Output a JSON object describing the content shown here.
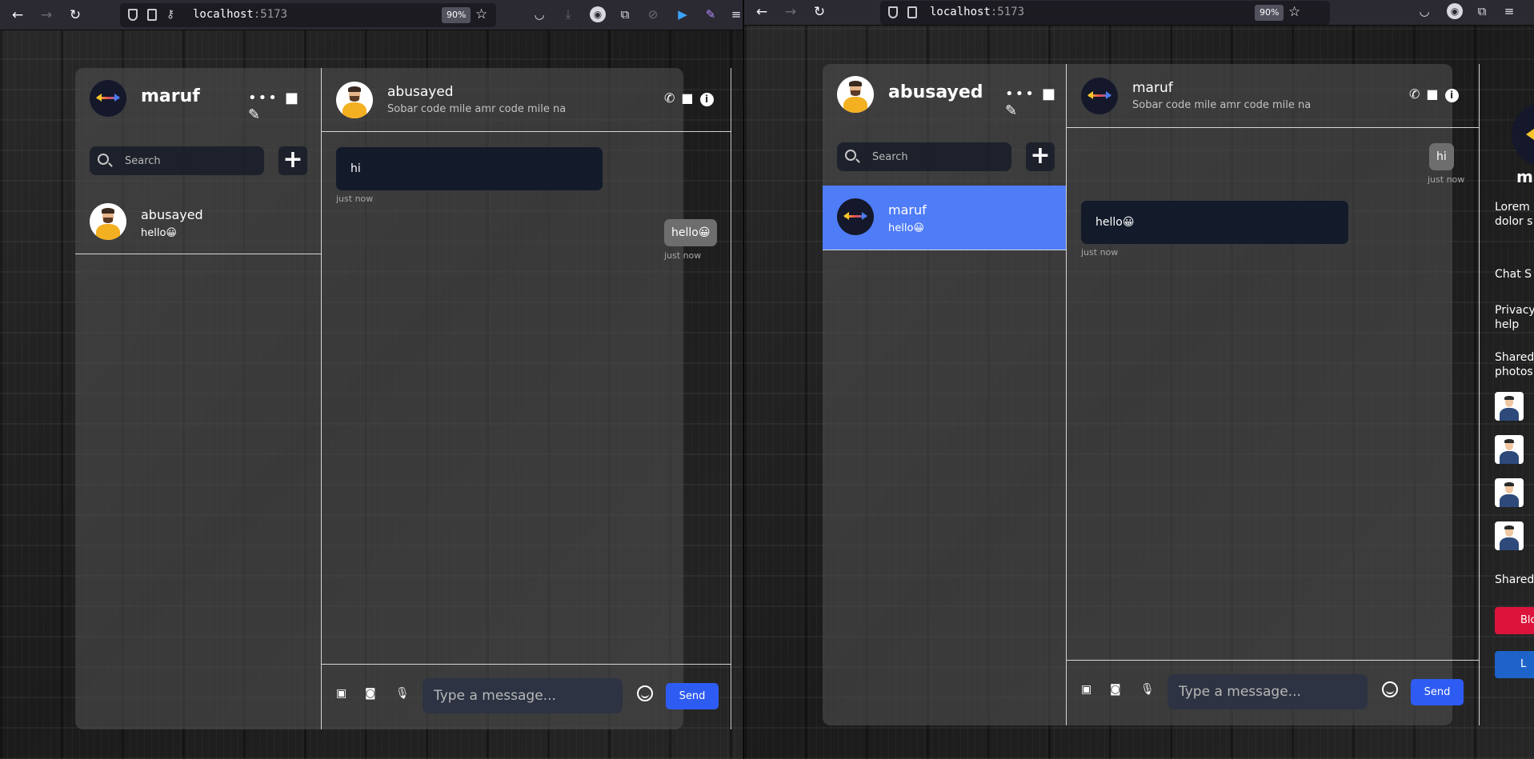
{
  "browser": {
    "host": "localhost",
    "port": ":5173",
    "zoom": "90%"
  },
  "left": {
    "current_user": "maruf",
    "search_placeholder": "Search",
    "contacts": [
      {
        "name": "abusayed",
        "last_message": "hello😀"
      }
    ],
    "chat": {
      "name": "abusayed",
      "status": "Sobar code mile amr code mile na",
      "messages": [
        {
          "text": "hi",
          "time": "just now"
        },
        {
          "text": "hello😀",
          "time": "just now"
        }
      ]
    },
    "message_placeholder": "Type a message...",
    "send_label": "Send"
  },
  "right": {
    "current_user": "abusayed",
    "search_placeholder": "Search",
    "contacts": [
      {
        "name": "maruf",
        "last_message": "hello😀"
      }
    ],
    "chat": {
      "name": "maruf",
      "status": "Sobar code mile amr code mile na",
      "messages": [
        {
          "text": "hi",
          "time": "just now"
        },
        {
          "text": "hello😀",
          "time": "just now"
        }
      ]
    },
    "message_placeholder": "Type a message...",
    "send_label": "Send",
    "details": {
      "name_partial": "m",
      "description": [
        "Lorem",
        "dolor s"
      ],
      "chat_settings": "Chat S",
      "privacy": [
        "Privacy",
        "help"
      ],
      "shared_photos": [
        "Shared",
        "photos"
      ],
      "shared_files": "Shared",
      "block_label": "Blo",
      "logout_label": "L"
    }
  },
  "colors": {
    "active_contact": "#4f7cf7",
    "send_button": "#2e5cf3",
    "block_button": "#dc143c",
    "logout_button": "#1e63c9"
  }
}
